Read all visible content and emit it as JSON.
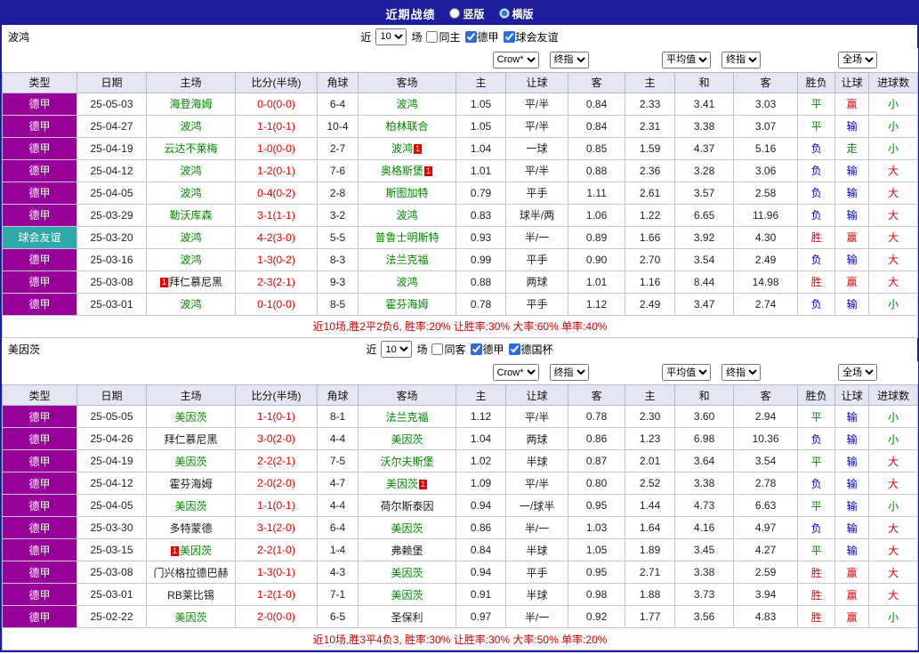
{
  "titlebar": {
    "title": "近期战绩",
    "options": [
      {
        "label": "竖版",
        "selected": false
      },
      {
        "label": "横版",
        "selected": true
      }
    ]
  },
  "colors": {
    "navy": "#1d1d9d",
    "type_league": "#990099",
    "type_friendly": "#2ea8a8",
    "team_green": "#008800",
    "team_dark": "#1a1a1a",
    "score_red": "#e60000",
    "win": "#e60000",
    "draw": "#008800",
    "lose": "#0000d0",
    "summary": "#d10000",
    "header_bg": "#e6e6f2"
  },
  "table_headers": [
    "类型",
    "日期",
    "主场",
    "比分(半场)",
    "角球",
    "客场",
    "主",
    "让球",
    "客",
    "主",
    "和",
    "客",
    "胜负",
    "让球",
    "进球数"
  ],
  "result_color_map": {
    "胜": "win",
    "赢": "win",
    "大": "win",
    "平": "draw",
    "走": "draw",
    "小": "draw",
    "负": "lose",
    "输": "lose"
  },
  "sections": [
    {
      "team": "波鸿",
      "filter": {
        "prefix": "近",
        "count": "10",
        "suffix": "场",
        "checkboxes": [
          {
            "label": "同主",
            "checked": false
          },
          {
            "label": "德甲",
            "checked": true
          },
          {
            "label": "球会友谊",
            "checked": true
          }
        ]
      },
      "dropdowns": {
        "odds_source": "Crow*",
        "odds_kind": "终指",
        "avg_source": "平均值",
        "avg_kind": "终指",
        "scope": "全场"
      },
      "rows": [
        {
          "type": "德甲",
          "date": "25-05-03",
          "home": "海登海姆",
          "home_card": "",
          "home_color": "green",
          "score": "0-0(0-0)",
          "corner": "6-4",
          "away": "波鸿",
          "away_card": "",
          "away_color": "green",
          "odds": [
            "1.05",
            "平/半",
            "0.84"
          ],
          "avg": [
            "2.33",
            "3.41",
            "3.03"
          ],
          "result": [
            "平",
            "赢",
            "小"
          ]
        },
        {
          "type": "德甲",
          "date": "25-04-27",
          "home": "波鸿",
          "home_card": "",
          "home_color": "green",
          "score": "1-1(0-1)",
          "corner": "10-4",
          "away": "柏林联合",
          "away_card": "",
          "away_color": "green",
          "odds": [
            "1.05",
            "平/半",
            "0.84"
          ],
          "avg": [
            "2.31",
            "3.38",
            "3.07"
          ],
          "result": [
            "平",
            "输",
            "小"
          ]
        },
        {
          "type": "德甲",
          "date": "25-04-19",
          "home": "云达不莱梅",
          "home_card": "",
          "home_color": "green",
          "score": "1-0(0-0)",
          "corner": "2-7",
          "away": "波鸿",
          "away_card": "1",
          "away_color": "green",
          "odds": [
            "1.04",
            "一球",
            "0.85"
          ],
          "avg": [
            "1.59",
            "4.37",
            "5.16"
          ],
          "result": [
            "负",
            "走",
            "小"
          ]
        },
        {
          "type": "德甲",
          "date": "25-04-12",
          "home": "波鸿",
          "home_card": "",
          "home_color": "green",
          "score": "1-2(0-1)",
          "corner": "7-6",
          "away": "奥格斯堡",
          "away_card": "1",
          "away_color": "green",
          "odds": [
            "1.01",
            "平/半",
            "0.88"
          ],
          "avg": [
            "2.36",
            "3.28",
            "3.06"
          ],
          "result": [
            "负",
            "输",
            "大"
          ]
        },
        {
          "type": "德甲",
          "date": "25-04-05",
          "home": "波鸿",
          "home_card": "",
          "home_color": "green",
          "score": "0-4(0-2)",
          "corner": "2-8",
          "away": "斯图加特",
          "away_card": "",
          "away_color": "green",
          "odds": [
            "0.79",
            "平手",
            "1.11"
          ],
          "avg": [
            "2.61",
            "3.57",
            "2.58"
          ],
          "result": [
            "负",
            "输",
            "大"
          ]
        },
        {
          "type": "德甲",
          "date": "25-03-29",
          "home": "勒沃库森",
          "home_card": "",
          "home_color": "green",
          "score": "3-1(1-1)",
          "corner": "3-2",
          "away": "波鸿",
          "away_card": "",
          "away_color": "green",
          "odds": [
            "0.83",
            "球半/两",
            "1.06"
          ],
          "avg": [
            "1.22",
            "6.65",
            "11.96"
          ],
          "result": [
            "负",
            "输",
            "大"
          ]
        },
        {
          "type": "球会友谊",
          "date": "25-03-20",
          "home": "波鸿",
          "home_card": "",
          "home_color": "green",
          "score": "4-2(3-0)",
          "corner": "5-5",
          "away": "普鲁士明斯特",
          "away_card": "",
          "away_color": "green",
          "odds": [
            "0.93",
            "半/一",
            "0.89"
          ],
          "avg": [
            "1.66",
            "3.92",
            "4.30"
          ],
          "result": [
            "胜",
            "赢",
            "大"
          ]
        },
        {
          "type": "德甲",
          "date": "25-03-16",
          "home": "波鸿",
          "home_card": "",
          "home_color": "green",
          "score": "1-3(0-2)",
          "corner": "8-3",
          "away": "法兰克福",
          "away_card": "",
          "away_color": "green",
          "odds": [
            "0.99",
            "平手",
            "0.90"
          ],
          "avg": [
            "2.70",
            "3.54",
            "2.49"
          ],
          "result": [
            "负",
            "输",
            "大"
          ]
        },
        {
          "type": "德甲",
          "date": "25-03-08",
          "home": "拜仁慕尼黑",
          "home_card": "1",
          "home_color": "dark",
          "score": "2-3(2-1)",
          "corner": "9-3",
          "away": "波鸿",
          "away_card": "",
          "away_color": "green",
          "odds": [
            "0.88",
            "两球",
            "1.01"
          ],
          "avg": [
            "1.16",
            "8.44",
            "14.98"
          ],
          "result": [
            "胜",
            "赢",
            "大"
          ]
        },
        {
          "type": "德甲",
          "date": "25-03-01",
          "home": "波鸿",
          "home_card": "",
          "home_color": "green",
          "score": "0-1(0-0)",
          "corner": "8-5",
          "away": "霍芬海姆",
          "away_card": "",
          "away_color": "green",
          "odds": [
            "0.78",
            "平手",
            "1.12"
          ],
          "avg": [
            "2.49",
            "3.47",
            "2.74"
          ],
          "result": [
            "负",
            "输",
            "小"
          ]
        }
      ],
      "summary": "近10场,胜2平2负6, 胜率:20% 让胜率:30% 大率:60% 单率:40%"
    },
    {
      "team": "美因茨",
      "filter": {
        "prefix": "近",
        "count": "10",
        "suffix": "场",
        "checkboxes": [
          {
            "label": "同客",
            "checked": false
          },
          {
            "label": "德甲",
            "checked": true
          },
          {
            "label": "德国杯",
            "checked": true
          }
        ]
      },
      "dropdowns": {
        "odds_source": "Crow*",
        "odds_kind": "终指",
        "avg_source": "平均值",
        "avg_kind": "终指",
        "scope": "全场"
      },
      "rows": [
        {
          "type": "德甲",
          "date": "25-05-05",
          "home": "美因茨",
          "home_card": "",
          "home_color": "green",
          "score": "1-1(0-1)",
          "corner": "8-1",
          "away": "法兰克福",
          "away_card": "",
          "away_color": "green",
          "odds": [
            "1.12",
            "平/半",
            "0.78"
          ],
          "avg": [
            "2.30",
            "3.60",
            "2.94"
          ],
          "result": [
            "平",
            "输",
            "小"
          ]
        },
        {
          "type": "德甲",
          "date": "25-04-26",
          "home": "拜仁慕尼黑",
          "home_card": "",
          "home_color": "dark",
          "score": "3-0(2-0)",
          "corner": "4-4",
          "away": "美因茨",
          "away_card": "",
          "away_color": "green",
          "odds": [
            "1.04",
            "两球",
            "0.86"
          ],
          "avg": [
            "1.23",
            "6.98",
            "10.36"
          ],
          "result": [
            "负",
            "输",
            "小"
          ]
        },
        {
          "type": "德甲",
          "date": "25-04-19",
          "home": "美因茨",
          "home_card": "",
          "home_color": "green",
          "score": "2-2(2-1)",
          "corner": "7-5",
          "away": "沃尔夫斯堡",
          "away_card": "",
          "away_color": "green",
          "odds": [
            "1.02",
            "半球",
            "0.87"
          ],
          "avg": [
            "2.01",
            "3.64",
            "3.54"
          ],
          "result": [
            "平",
            "输",
            "大"
          ]
        },
        {
          "type": "德甲",
          "date": "25-04-12",
          "home": "霍芬海姆",
          "home_card": "",
          "home_color": "dark",
          "score": "2-0(2-0)",
          "corner": "4-7",
          "away": "美因茨",
          "away_card": "1",
          "away_color": "green",
          "odds": [
            "1.09",
            "平/半",
            "0.80"
          ],
          "avg": [
            "2.52",
            "3.38",
            "2.78"
          ],
          "result": [
            "负",
            "输",
            "大"
          ]
        },
        {
          "type": "德甲",
          "date": "25-04-05",
          "home": "美因茨",
          "home_card": "",
          "home_color": "green",
          "score": "1-1(0-1)",
          "corner": "4-4",
          "away": "荷尔斯泰因",
          "away_card": "",
          "away_color": "dark",
          "odds": [
            "0.94",
            "一/球半",
            "0.95"
          ],
          "avg": [
            "1.44",
            "4.73",
            "6.63"
          ],
          "result": [
            "平",
            "输",
            "小"
          ]
        },
        {
          "type": "德甲",
          "date": "25-03-30",
          "home": "多特蒙德",
          "home_card": "",
          "home_color": "dark",
          "score": "3-1(2-0)",
          "corner": "6-4",
          "away": "美因茨",
          "away_card": "",
          "away_color": "green",
          "odds": [
            "0.86",
            "半/一",
            "1.03"
          ],
          "avg": [
            "1.64",
            "4.16",
            "4.97"
          ],
          "result": [
            "负",
            "输",
            "大"
          ]
        },
        {
          "type": "德甲",
          "date": "25-03-15",
          "home": "美因茨",
          "home_card": "1",
          "home_color": "green",
          "score": "2-2(1-0)",
          "corner": "1-4",
          "away": "弗赖堡",
          "away_card": "",
          "away_color": "dark",
          "odds": [
            "0.84",
            "半球",
            "1.05"
          ],
          "avg": [
            "1.89",
            "3.45",
            "4.27"
          ],
          "result": [
            "平",
            "输",
            "大"
          ]
        },
        {
          "type": "德甲",
          "date": "25-03-08",
          "home": "门兴格拉德巴赫",
          "home_card": "",
          "home_color": "dark",
          "score": "1-3(0-1)",
          "corner": "4-3",
          "away": "美因茨",
          "away_card": "",
          "away_color": "green",
          "odds": [
            "0.94",
            "平手",
            "0.95"
          ],
          "avg": [
            "2.71",
            "3.38",
            "2.59"
          ],
          "result": [
            "胜",
            "赢",
            "大"
          ]
        },
        {
          "type": "德甲",
          "date": "25-03-01",
          "home": "RB莱比锡",
          "home_card": "",
          "home_color": "dark",
          "score": "1-2(1-0)",
          "corner": "7-1",
          "away": "美因茨",
          "away_card": "",
          "away_color": "green",
          "odds": [
            "0.91",
            "半球",
            "0.98"
          ],
          "avg": [
            "1.88",
            "3.73",
            "3.94"
          ],
          "result": [
            "胜",
            "赢",
            "大"
          ]
        },
        {
          "type": "德甲",
          "date": "25-02-22",
          "home": "美因茨",
          "home_card": "",
          "home_color": "green",
          "score": "2-0(0-0)",
          "corner": "6-5",
          "away": "圣保利",
          "away_card": "",
          "away_color": "dark",
          "odds": [
            "0.97",
            "半/一",
            "0.92"
          ],
          "avg": [
            "1.77",
            "3.56",
            "4.83"
          ],
          "result": [
            "胜",
            "赢",
            "小"
          ]
        }
      ],
      "summary": "近10场,胜3平4负3, 胜率:30% 让胜率:30% 大率:50% 单率:20%"
    }
  ]
}
